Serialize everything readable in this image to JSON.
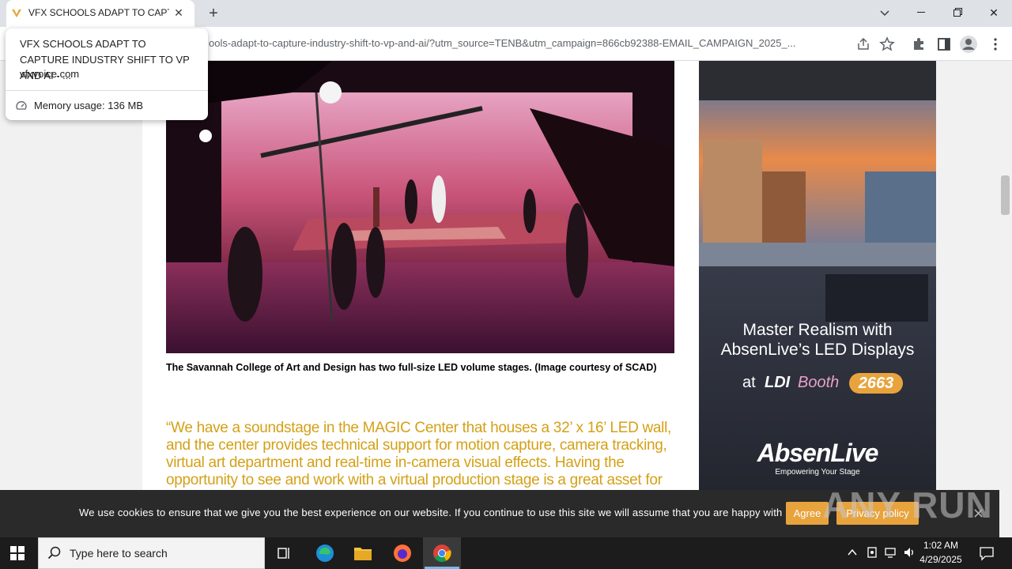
{
  "browser": {
    "tab_title": "VFX SCHOOLS ADAPT TO CAPTURE",
    "url": "ools-adapt-to-capture-industry-shift-to-vp-and-ai/?utm_source=TENB&utm_campaign=866cb92388-EMAIL_CAMPAIGN_2025_...",
    "hover_card": {
      "title": "VFX SCHOOLS ADAPT TO CAPTURE INDUSTRY SHIFT TO VP AND AI - ...",
      "domain": "vfxvoice.com",
      "memory": "Memory usage: 136 MB"
    }
  },
  "article": {
    "caption": "The Savannah College of Art and Design has two full-size LED volume stages. (Image courtesy of SCAD)",
    "quote": "“We have a soundstage in the MAGIC Center that houses a 32’ x 16’ LED wall, and the center provides technical support for motion capture, camera tracking, virtual art department and real-time in-camera visual effects. Having the opportunity to see and work with a virtual production stage is a great asset for our graduates.”"
  },
  "ad": {
    "headline_1": "Master Realism with",
    "headline_2": "AbsenLive’s LED Displays",
    "at": "at",
    "ldi": "LDI",
    "booth": "Booth",
    "booth_number": "2663",
    "brand": "AbsenLive",
    "tagline": "Empowering Your Stage"
  },
  "cookie": {
    "text": "We use cookies to ensure that we give you the best experience on our website. If you continue to use this site we will assume that you are happy with it.",
    "agree": "Agree",
    "privacy": "Privacy policy"
  },
  "watermark": "ANY RUN",
  "taskbar": {
    "search_placeholder": "Type here to search",
    "time": "1:02 AM",
    "date": "4/29/2025"
  }
}
